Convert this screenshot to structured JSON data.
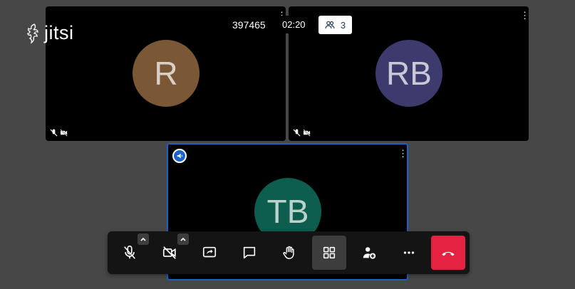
{
  "branding": {
    "logo_text": "jitsi"
  },
  "header": {
    "room_id": "397465",
    "timer": "02:20",
    "participant_count": "3"
  },
  "participants": [
    {
      "initials": "R",
      "color": "#7a5836"
    },
    {
      "initials": "RB",
      "color": "#3d3b6e"
    },
    {
      "initials": "TB",
      "color": "#0d5e4e"
    }
  ],
  "tile_menu_glyph": "⋮",
  "toolbar": {
    "buttons": [
      {
        "name": "microphone",
        "icon": "mic-off-icon"
      },
      {
        "name": "camera",
        "icon": "video-off-icon"
      },
      {
        "name": "share-screen",
        "icon": "screen-share-icon"
      },
      {
        "name": "chat",
        "icon": "chat-icon"
      },
      {
        "name": "raise-hand",
        "icon": "hand-icon"
      },
      {
        "name": "tile-view",
        "icon": "grid-icon"
      },
      {
        "name": "invite",
        "icon": "add-person-icon"
      },
      {
        "name": "more",
        "icon": "more-horizontal-icon"
      },
      {
        "name": "hangup",
        "icon": "phone-hangup-icon"
      }
    ],
    "hangup_color": "#e52242",
    "active_button": "tile-view"
  },
  "colors": {
    "background": "#474747",
    "dominant_border": "#1a63c9"
  }
}
